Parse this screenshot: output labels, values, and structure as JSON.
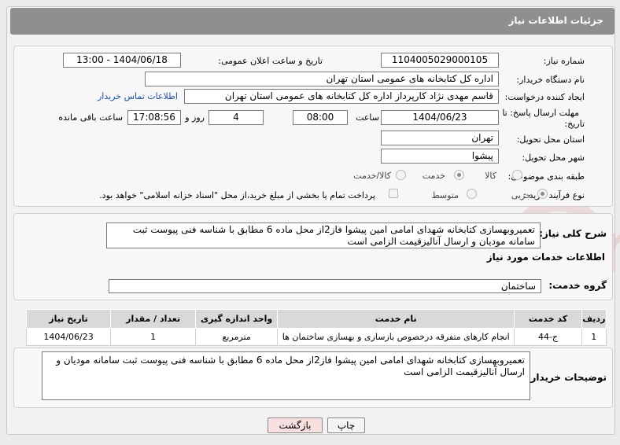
{
  "header": {
    "title": "جزئیات اطلاعات نیاز"
  },
  "form": {
    "need_number_label": "شماره نیاز:",
    "need_number": "1104005029000105",
    "announce_label": "تاریخ و ساعت اعلان عمومی:",
    "announce_value": "1404/06/18 - 13:00",
    "buyer_org_label": "نام دستگاه خریدار:",
    "buyer_org": "اداره کل کتابخانه های عمومی استان تهران",
    "requester_label": "ایجاد کننده درخواست:",
    "requester": "قاسم مهدی نژاد کارپرداز اداره کل کتابخانه های عمومی استان تهران",
    "contact_link": "اطلاعات تماس خریدار",
    "deadline_label_line1": "مهلت ارسال پاسخ: تا",
    "deadline_label_line2": "تاریخ:",
    "deadline_date": "1404/06/23",
    "time_label": "ساعت",
    "deadline_time": "08:00",
    "days_value": "4",
    "days_label": "روز و",
    "remaining_time": "17:08:56",
    "remaining_label": "ساعت باقی مانده",
    "province_label": "استان محل تحویل:",
    "province": "تهران",
    "city_label": "شهر محل تحویل:",
    "city": "پیشوا",
    "category_label": "طبقه بندی موضوعی:",
    "category_options": [
      "کالا",
      "خدمت",
      "کالا/خدمت"
    ],
    "process_label": "نوع فرآیند خرید :",
    "process_options": [
      "جزیی",
      "متوسط"
    ],
    "payment_note": "پرداخت تمام یا بخشی از مبلغ خرید،از محل \"اسناد خزانه اسلامی\" خواهد بود."
  },
  "summary": {
    "label": "شرح کلی نیاز:",
    "text": "تعمیروبهسازی کتابخانه شهدای امامی امین پیشوا فاز2از محل ماده 6 مطابق با شناسه فنی پیوست ثبت سامانه مودیان و ارسال آنالیزقیمت الزامی است",
    "services_title": "اطلاعات خدمات مورد نیاز",
    "service_group_label": "گروه خدمت:",
    "service_group": "ساختمان"
  },
  "table": {
    "headers": [
      "ردیف",
      "کد خدمت",
      "نام خدمت",
      "واحد اندازه گیری",
      "تعداد / مقدار",
      "تاریخ نیاز"
    ],
    "rows": [
      [
        "1",
        "ج-44",
        "انجام کارهای متفرقه درخصوص بازسازی و بهسازی ساختمان ها",
        "مترمربع",
        "1",
        "1404/06/23"
      ]
    ]
  },
  "buyer_notes": {
    "label": "توضیحات خریدار:",
    "text": "تعمیروبهسازی کتابخانه شهدای امامی امین پیشوا فاز2از محل ماده 6 مطابق با شناسه فنی پیوست ثبت سامانه مودیان و ارسال آنالیزقیمت الزامی است"
  },
  "buttons": {
    "print": "چاپ",
    "back": "بازگشت"
  },
  "watermark_text": "AriaTender.neT",
  "colors": {
    "title_bar": "#8f8f8f",
    "back_button": "#f8e0e0",
    "link": "#1a4fb5",
    "watermark": "#c83a3a"
  }
}
